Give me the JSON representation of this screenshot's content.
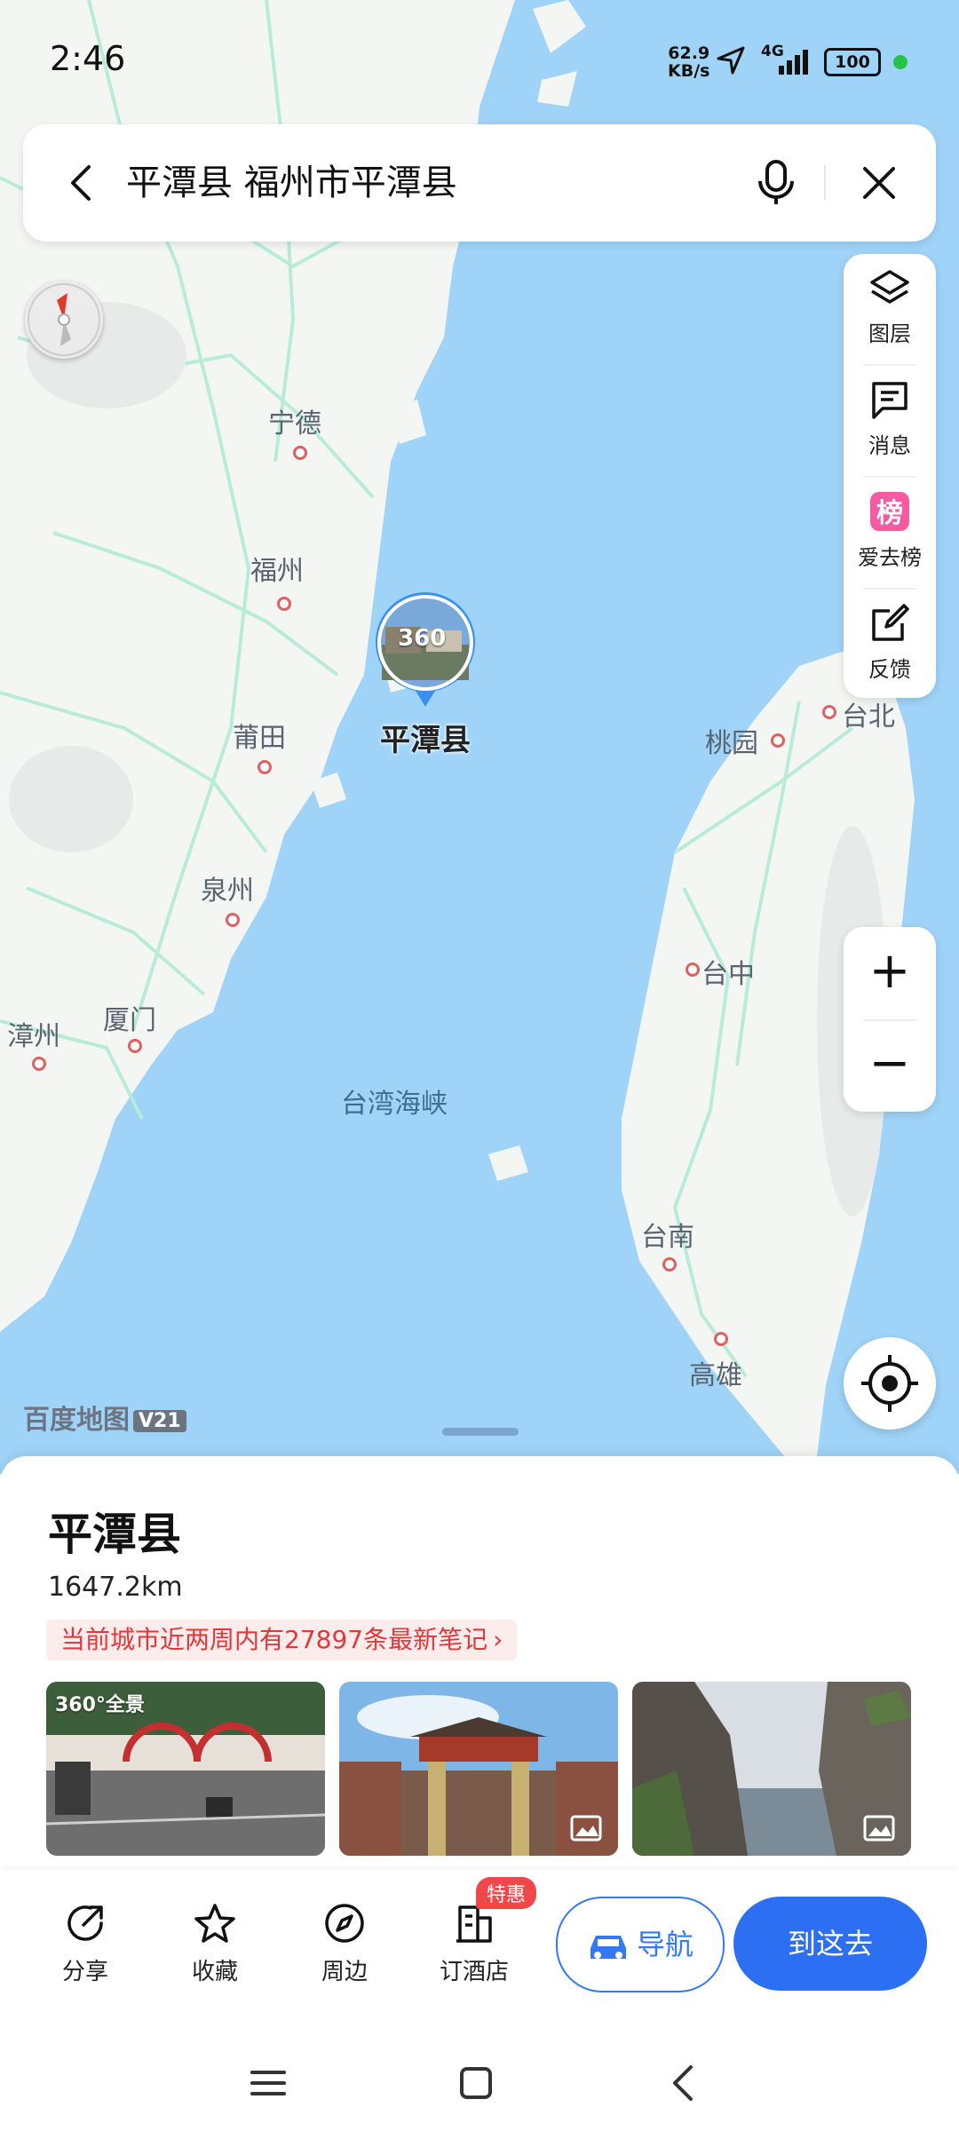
{
  "status_bar": {
    "time": "2:46",
    "net_speed_value": "62.9",
    "net_speed_unit": "KB/s",
    "network": "4G",
    "battery": "100"
  },
  "search": {
    "query": "平潭县 福州市平潭县"
  },
  "map_tools": [
    {
      "label": "图层",
      "icon": "layers-icon"
    },
    {
      "label": "消息",
      "icon": "message-icon"
    },
    {
      "label": "爱去榜",
      "icon": "ranking-icon"
    },
    {
      "label": "反馈",
      "icon": "feedback-icon"
    }
  ],
  "zoom": {
    "in": "+",
    "out": "−"
  },
  "map_labels": {
    "ningde": "宁德",
    "fuzhou": "福州",
    "putian": "莆田",
    "quanzhou": "泉州",
    "zhangzhou": "漳州",
    "xiamen": "厦门",
    "strait": "台湾海峡",
    "taoyuan": "桃园",
    "taibei": "台北",
    "taizhong": "台中",
    "tainan": "台南",
    "gaoxiong": "高雄"
  },
  "pin": {
    "badge": "360",
    "label": "平潭县"
  },
  "watermark": {
    "text": "百度地图",
    "version": "V21"
  },
  "place": {
    "title": "平潭县",
    "distance": "1647.2km",
    "notes_banner": "当前城市近两周内有27897条最新笔记",
    "photos": [
      {
        "badge": "360°全景"
      },
      {
        "badge": ""
      },
      {
        "badge": ""
      }
    ]
  },
  "actions": {
    "share": "分享",
    "favorite": "收藏",
    "nearby": "周边",
    "hotel": "订酒店",
    "hotel_badge": "特惠",
    "navigate": "导航",
    "go_here": "到这去"
  },
  "colors": {
    "accent": "#2d6ff2",
    "sea": "#9fd3f7",
    "land": "#f4f6f4",
    "road": "#b8ecd9",
    "promo": "#e0383b"
  }
}
